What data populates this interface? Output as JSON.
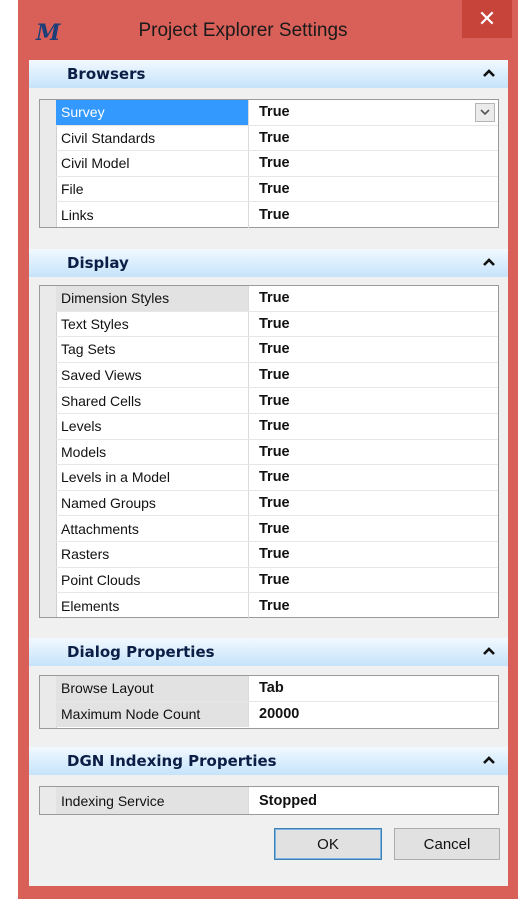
{
  "window": {
    "title": "Project Explorer Settings",
    "app_icon": "bentley-m-icon",
    "close_symbol": "✕"
  },
  "sections": [
    {
      "title": "Browsers",
      "rows": [
        {
          "name": "Survey",
          "value": "True"
        },
        {
          "name": "Civil Standards",
          "value": "True"
        },
        {
          "name": "Civil Model",
          "value": "True"
        },
        {
          "name": "File",
          "value": "True"
        },
        {
          "name": "Links",
          "value": "True"
        }
      ]
    },
    {
      "title": "Display",
      "rows": [
        {
          "name": "Dimension Styles",
          "value": "True"
        },
        {
          "name": "Text Styles",
          "value": "True"
        },
        {
          "name": "Tag Sets",
          "value": "True"
        },
        {
          "name": "Saved Views",
          "value": "True"
        },
        {
          "name": "Shared Cells",
          "value": "True"
        },
        {
          "name": "Levels",
          "value": "True"
        },
        {
          "name": "Models",
          "value": "True"
        },
        {
          "name": "Levels in a Model",
          "value": "True"
        },
        {
          "name": "Named Groups",
          "value": "True"
        },
        {
          "name": "Attachments",
          "value": "True"
        },
        {
          "name": "Rasters",
          "value": "True"
        },
        {
          "name": "Point Clouds",
          "value": "True"
        },
        {
          "name": "Elements",
          "value": "True"
        }
      ]
    },
    {
      "title": "Dialog Properties",
      "rows": [
        {
          "name": "Browse Layout",
          "value": "Tab"
        },
        {
          "name": "Maximum Node Count",
          "value": "20000"
        }
      ]
    },
    {
      "title": "DGN Indexing Properties",
      "rows": [
        {
          "name": "Indexing Service",
          "value": "Stopped"
        }
      ]
    }
  ],
  "buttons": {
    "ok": "OK",
    "cancel": "Cancel"
  },
  "colors": {
    "titlebar": "#d86058",
    "close_button": "#c7443a",
    "selection": "#3399ff",
    "section_header": "#c6e3fa"
  }
}
